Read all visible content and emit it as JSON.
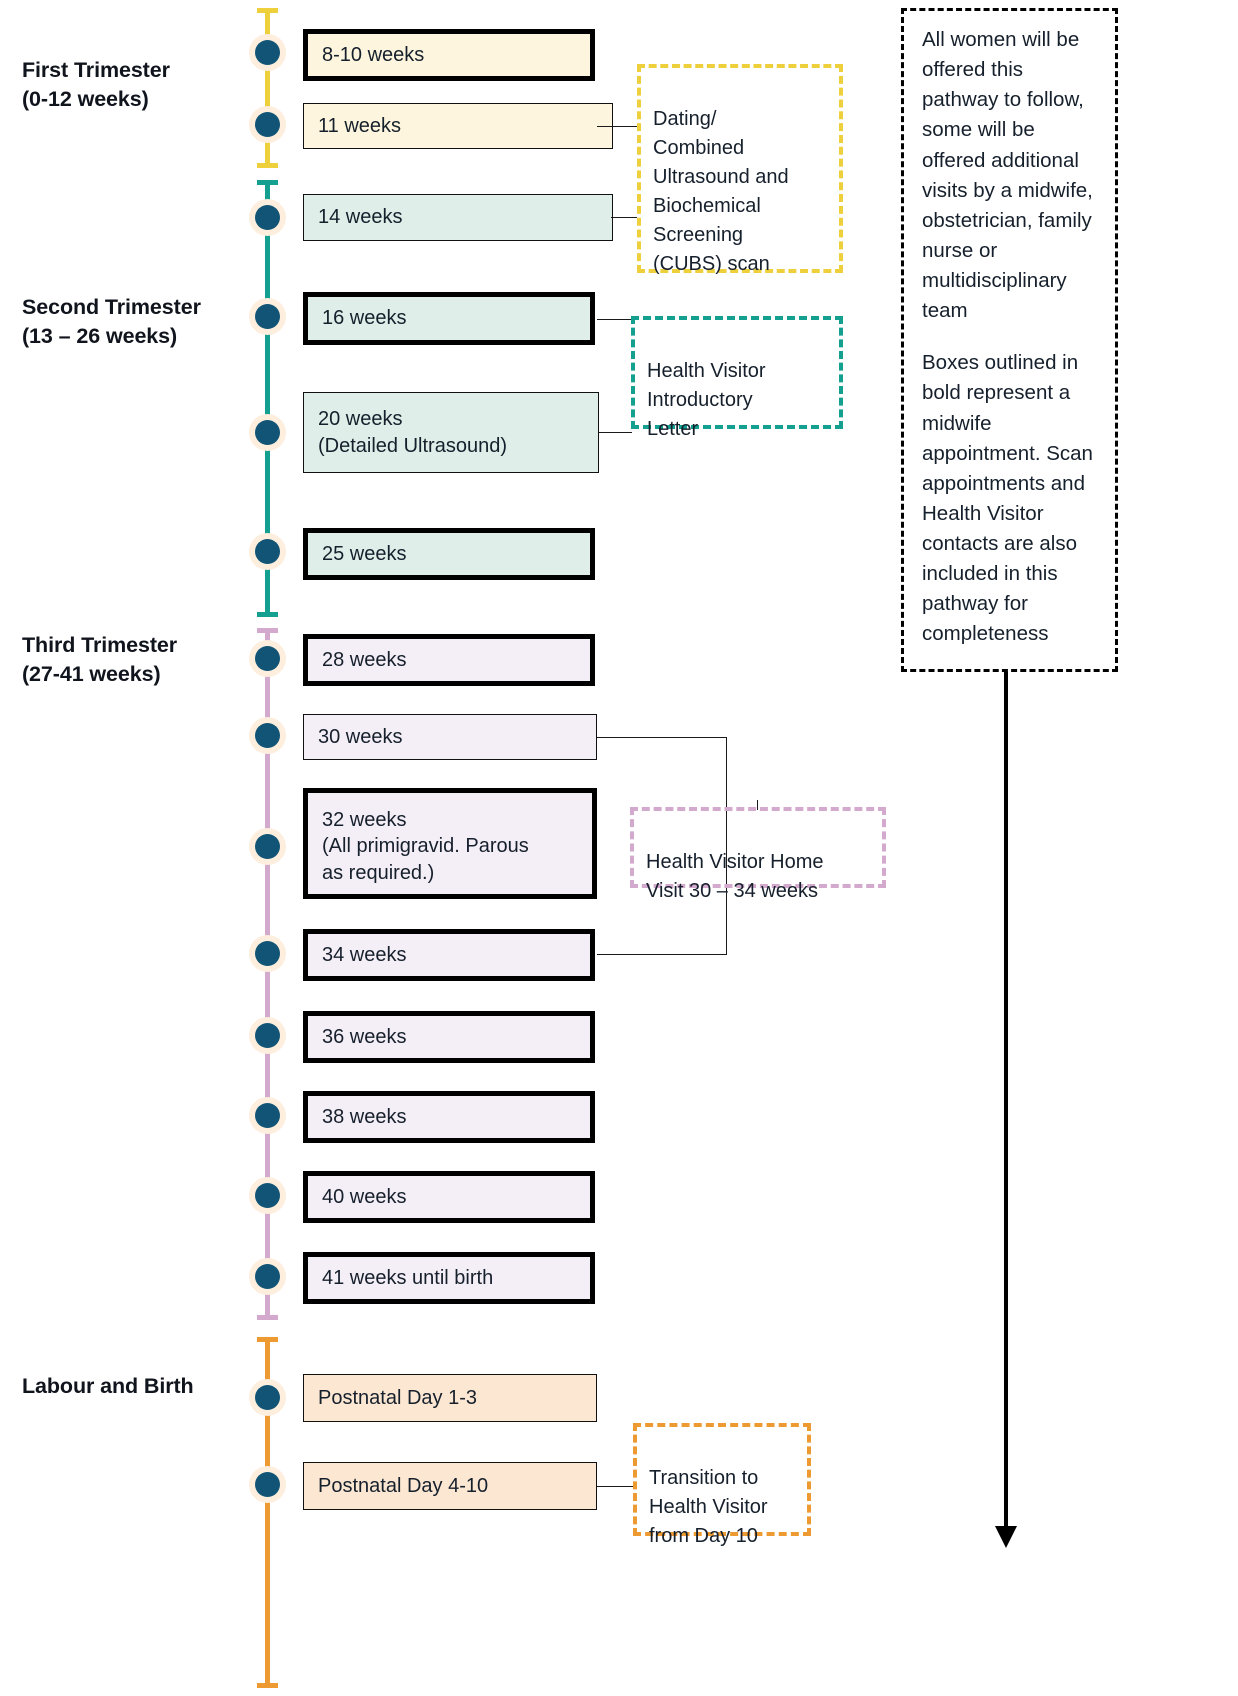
{
  "diagram": {
    "title": "Maternity Care Pathway Timeline",
    "colors": {
      "first_trimester_rail": "#edd03c",
      "second_trimester_rail": "#14a090",
      "third_trimester_rail": "#d3aacd",
      "labour_rail": "#ee9a33",
      "dot_fill": "#115475",
      "dot_ring": "#fdeedd",
      "first_box_fill": "#fdf5dd",
      "second_box_fill": "#dfeee9",
      "third_box_fill": "#f4eef6",
      "labour_box_fill": "#fce7d3",
      "note_border": "#000000"
    },
    "stages": [
      {
        "id": "first-trimester",
        "label": "First Trimester\n(0-12 weeks)",
        "rail_color": "#edd03c",
        "box_fill": "#fdf5dd",
        "events": [
          {
            "label": "8-10 weeks",
            "bold": true
          },
          {
            "label": "11 weeks",
            "bold": false
          }
        ]
      },
      {
        "id": "second-trimester",
        "label": "Second Trimester\n(13 – 26 weeks)",
        "rail_color": "#14a090",
        "box_fill": "#dfeee9",
        "events": [
          {
            "label": "14 weeks",
            "bold": false
          },
          {
            "label": "16 weeks",
            "bold": true
          },
          {
            "label": "20 weeks\n(Detailed Ultrasound)",
            "bold": false
          },
          {
            "label": "25 weeks",
            "bold": true
          }
        ]
      },
      {
        "id": "third-trimester",
        "label": "Third Trimester\n(27-41 weeks)",
        "rail_color": "#d3aacd",
        "box_fill": "#f4eef6",
        "events": [
          {
            "label": "28 weeks",
            "bold": true
          },
          {
            "label": "30 weeks",
            "bold": false
          },
          {
            "label": "32 weeks\n(All primigravid. Parous\nas required.)",
            "bold": true
          },
          {
            "label": "34 weeks",
            "bold": true
          },
          {
            "label": "36 weeks",
            "bold": true
          },
          {
            "label": "38 weeks",
            "bold": true
          },
          {
            "label": "40 weeks",
            "bold": true
          },
          {
            "label": "41 weeks until birth",
            "bold": true
          }
        ]
      },
      {
        "id": "labour-and-birth",
        "label": "Labour and Birth",
        "rail_color": "#ee9a33",
        "box_fill": "#fce7d3",
        "events": [
          {
            "label": "Postnatal Day 1-3",
            "bold": false
          },
          {
            "label": "Postnatal Day 4-10",
            "bold": false
          }
        ]
      }
    ],
    "callouts": [
      {
        "id": "cubs-scan",
        "text": "Dating/\nCombined\nUltrasound and\nBiochemical\nScreening\n(CUBS) scan",
        "border_color": "#edd03c",
        "linked_events": [
          "11 weeks",
          "14 weeks"
        ]
      },
      {
        "id": "health-visitor-introductory-letter",
        "text": "Health Visitor\nIntroductory\nLetter",
        "border_color": "#14a090",
        "linked_events": [
          "16 weeks",
          "20 weeks"
        ]
      },
      {
        "id": "health-visitor-home-visit",
        "text": "Health Visitor Home\nVisit 30 – 34 weeks",
        "border_color": "#d3aacd",
        "linked_events": [
          "30 weeks",
          "34 weeks"
        ]
      },
      {
        "id": "transition-to-health-visitor",
        "text": "Transition to\nHealth Visitor\nfrom Day 10",
        "border_color": "#ee9a33",
        "linked_events": [
          "Postnatal Day 4-10"
        ]
      }
    ],
    "note": {
      "paragraph_1": "All women will be offered this pathway to follow, some will be offered additional visits by a midwife, obstetrician, family nurse or multidisciplinary team",
      "paragraph_2": "Boxes outlined in bold represent a midwife appointment. Scan appointments and Health Visitor contacts are also included in this pathway for completeness"
    }
  }
}
